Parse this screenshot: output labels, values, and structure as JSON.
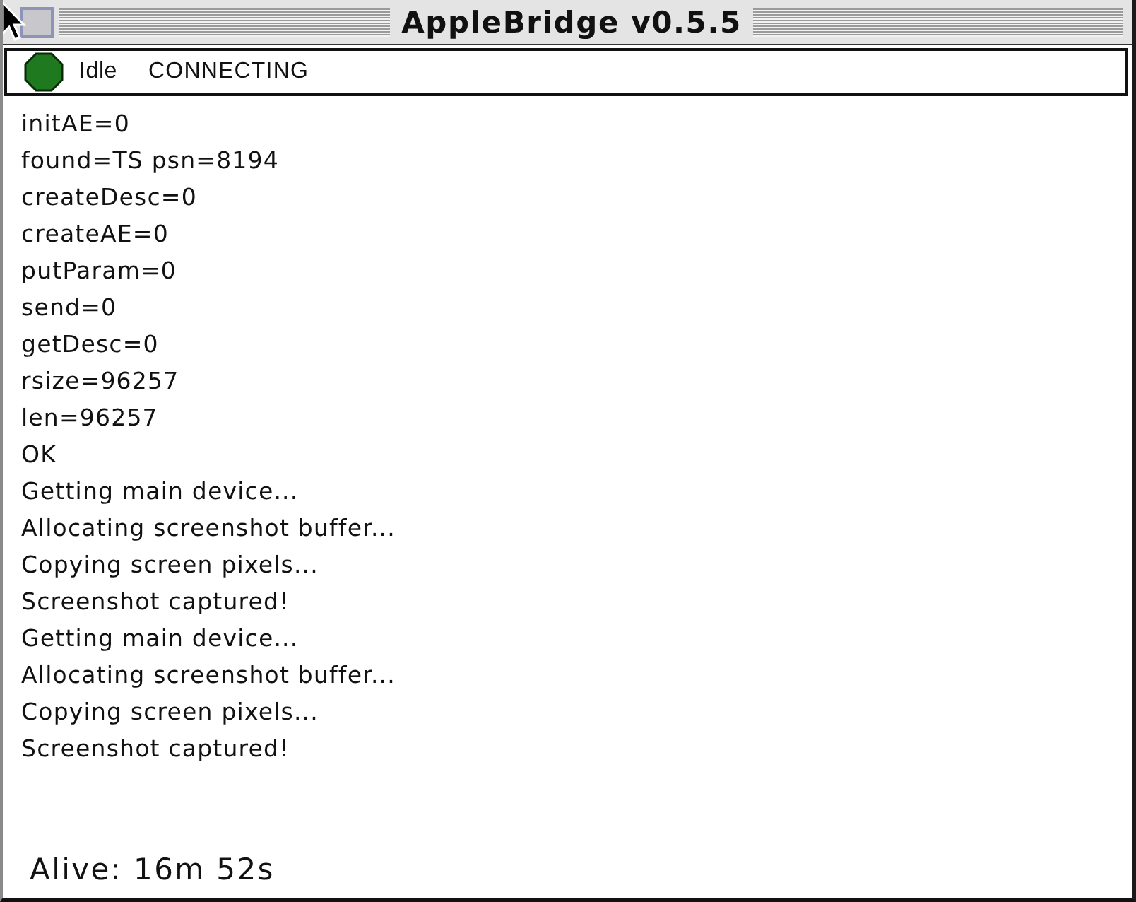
{
  "window": {
    "title": "AppleBridge v0.5.5"
  },
  "status_bar": {
    "state": "Idle",
    "connection": "CONNECTING"
  },
  "log": [
    "initAE=0",
    "found=TS psn=8194",
    "createDesc=0",
    "createAE=0",
    "putParam=0",
    "send=0",
    "getDesc=0",
    "rsize=96257",
    "len=96257",
    "OK",
    "Getting main device...",
    "Allocating screenshot buffer...",
    "Copying screen pixels...",
    "Screenshot captured!",
    "Getting main device...",
    "Allocating screenshot buffer...",
    "Copying screen pixels...",
    "Screenshot captured!"
  ],
  "footer": {
    "uptime": "Alive: 16m 52s"
  }
}
